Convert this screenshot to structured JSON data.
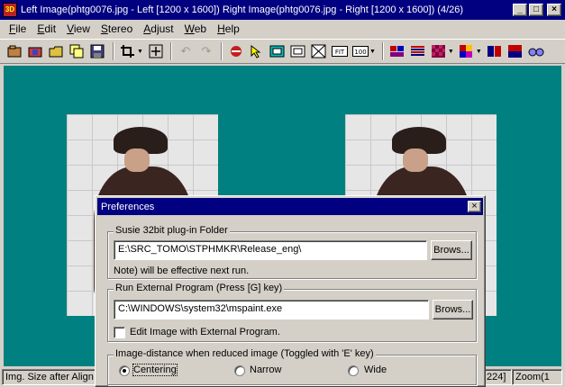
{
  "window": {
    "title": "Left Image(phtg0076.jpg - Left [1200 x 1600]) Right Image(phtg0076.jpg - Right [1200 x 1600])  (4/26)",
    "icon_text": "3D"
  },
  "menu": [
    "File",
    "Edit",
    "View",
    "Stereo",
    "Adjust",
    "Web",
    "Help"
  ],
  "toolbar": {
    "icons": [
      "open-icon",
      "open-stereo-icon",
      "open-folder-icon",
      "copy-icon",
      "save-icon",
      "crop-icon",
      "move-icon",
      "undo-icon",
      "redo-icon",
      "swap-icon",
      "pointer-icon",
      "frame-icon",
      "frame-outline-icon",
      "fit-cross-icon",
      "fit-icon",
      "zoom-100-icon",
      "anaglyph-icon",
      "line-interleave-icon",
      "checker-icon",
      "color-mix-icon",
      "side-by-side-icon",
      "top-bottom-icon",
      "glasses-icon"
    ],
    "fit_label": "FIT",
    "zoom_label": "100"
  },
  "status": {
    "left": "Img. Size after Align",
    "right_dims": "224]",
    "zoom": "Zoom(1"
  },
  "dialog": {
    "title": "Preferences",
    "susie": {
      "label": "Susie 32bit plug-in Folder",
      "path": "E:\\SRC_TOMO\\STPHMKR\\Release_eng\\",
      "browse": "Brows...",
      "note": "Note) will be effective next run."
    },
    "external": {
      "label": "Run External Program (Press [G] key)",
      "path": "C:\\WINDOWS\\system32\\mspaint.exe",
      "browse": "Brows...",
      "checkbox_label": "Edit Image with External Program.",
      "checked": false
    },
    "distance": {
      "label": "Image-distance when reduced image (Toggled with 'E' key)",
      "options": [
        "Centering",
        "Narrow",
        "Wide"
      ],
      "selected": "Centering"
    }
  },
  "colors": {
    "titlebar": "#000080",
    "canvas": "#008080",
    "face": "#d4d0c8"
  }
}
